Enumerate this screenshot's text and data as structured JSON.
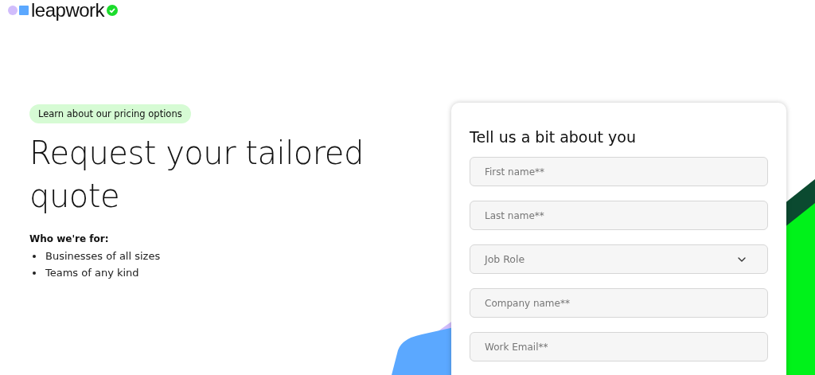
{
  "logo": {
    "text": "leapwork"
  },
  "intro": {
    "badge": "Learn about our pricing options",
    "title": "Request your tailored quote",
    "audience_label": "Who we're for:",
    "audience": [
      "Businesses of all sizes",
      "Teams of any kind"
    ]
  },
  "form": {
    "title": "Tell us a bit about you",
    "fields": [
      {
        "kind": "text",
        "placeholder": "First name**"
      },
      {
        "kind": "text",
        "placeholder": "Last name**"
      },
      {
        "kind": "select",
        "placeholder": "Job Role"
      },
      {
        "kind": "text",
        "placeholder": "Company name**"
      },
      {
        "kind": "text",
        "placeholder": "Work Email**"
      }
    ]
  }
}
